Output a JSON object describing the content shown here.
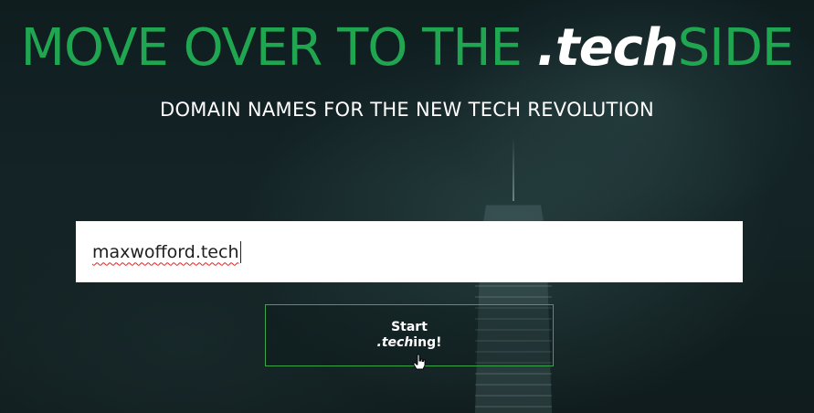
{
  "headline": {
    "prefix": "MOVE OVER TO THE ",
    "tld": ".tech",
    "suffix": "SIDE"
  },
  "subtitle": "DOMAIN NAMES FOR THE NEW TECH REVOLUTION",
  "search": {
    "value": "maxwofford.tech"
  },
  "start_button": {
    "line1": "Start",
    "line2_tld": ".tech",
    "line2_suffix": "ing!"
  },
  "colors": {
    "accent_green": "#20a650",
    "button_border": "#3da64c",
    "background": "#0c1718"
  },
  "icons": {
    "cursor": "hand-pointer-icon"
  }
}
